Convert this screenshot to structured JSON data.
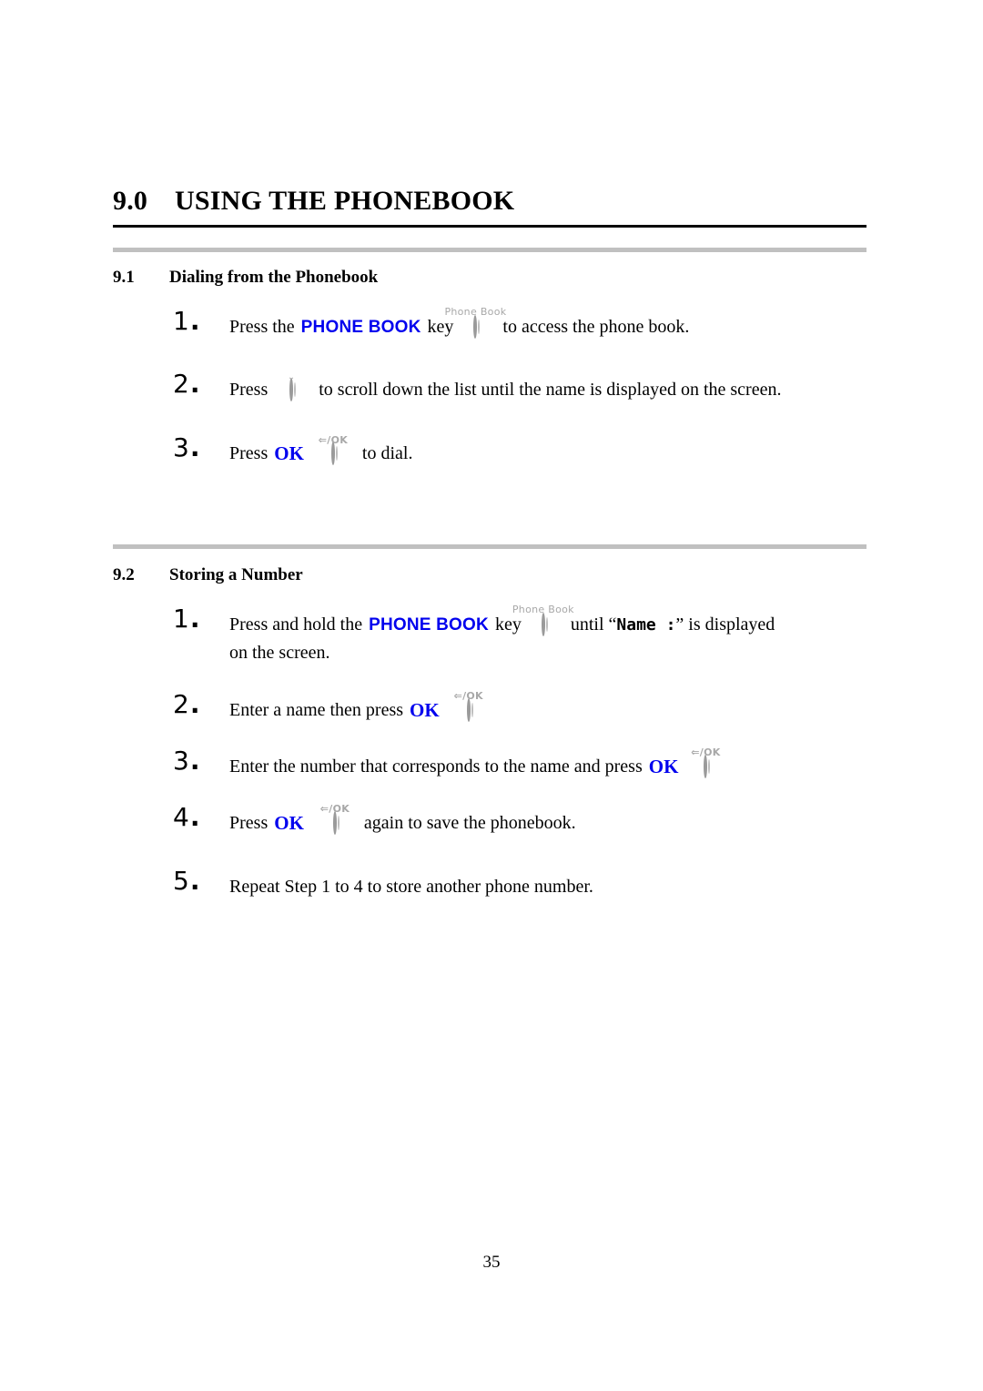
{
  "document": {
    "chapter": {
      "number": "9.0",
      "title": "USING THE PHONEBOOK"
    },
    "page_number": "35",
    "colors": {
      "keyword": "#0000EE",
      "separator": "#C0C0C0",
      "key_outline": "#9A9A9A",
      "key_label": "#A8A8A8"
    }
  },
  "keys": {
    "phone_book": {
      "label": "Phone Book",
      "name": "phone-book-key"
    },
    "scroll_down": {
      "label": "⌄",
      "name": "scroll-down-key"
    },
    "ok": {
      "label": "⇐/OK",
      "name": "ok-key"
    }
  },
  "sections": [
    {
      "number": "9.1",
      "title": "Dialing from the Phonebook",
      "steps": [
        {
          "num": "1",
          "parts": {
            "a": "Press the",
            "kw": "PHONE BOOK",
            "b": "key",
            "c": "to access the phone book."
          }
        },
        {
          "num": "2",
          "parts": {
            "a": "Press",
            "c": "to scroll down the list until the name is displayed on the screen."
          }
        },
        {
          "num": "3",
          "parts": {
            "a": "Press",
            "kw": "OK",
            "c": "to dial."
          }
        }
      ]
    },
    {
      "number": "9.2",
      "title": "Storing a Number",
      "steps": [
        {
          "num": "1",
          "parts": {
            "a": "Press and hold the",
            "kw": "PHONE BOOK",
            "b": "key",
            "c": "until “",
            "mono": "Name :",
            "d": "” is displayed",
            "line2": "on the screen."
          }
        },
        {
          "num": "2",
          "parts": {
            "a": "Enter a name then press",
            "kw": "OK"
          }
        },
        {
          "num": "3",
          "parts": {
            "a": "Enter the number that corresponds to the name and press",
            "kw": "OK"
          }
        },
        {
          "num": "4",
          "parts": {
            "a": "Press",
            "kw": "OK",
            "c": "again to save the phonebook."
          }
        },
        {
          "num": "5",
          "parts": {
            "a": "Repeat Step 1 to 4 to store another phone number."
          }
        }
      ]
    }
  ]
}
